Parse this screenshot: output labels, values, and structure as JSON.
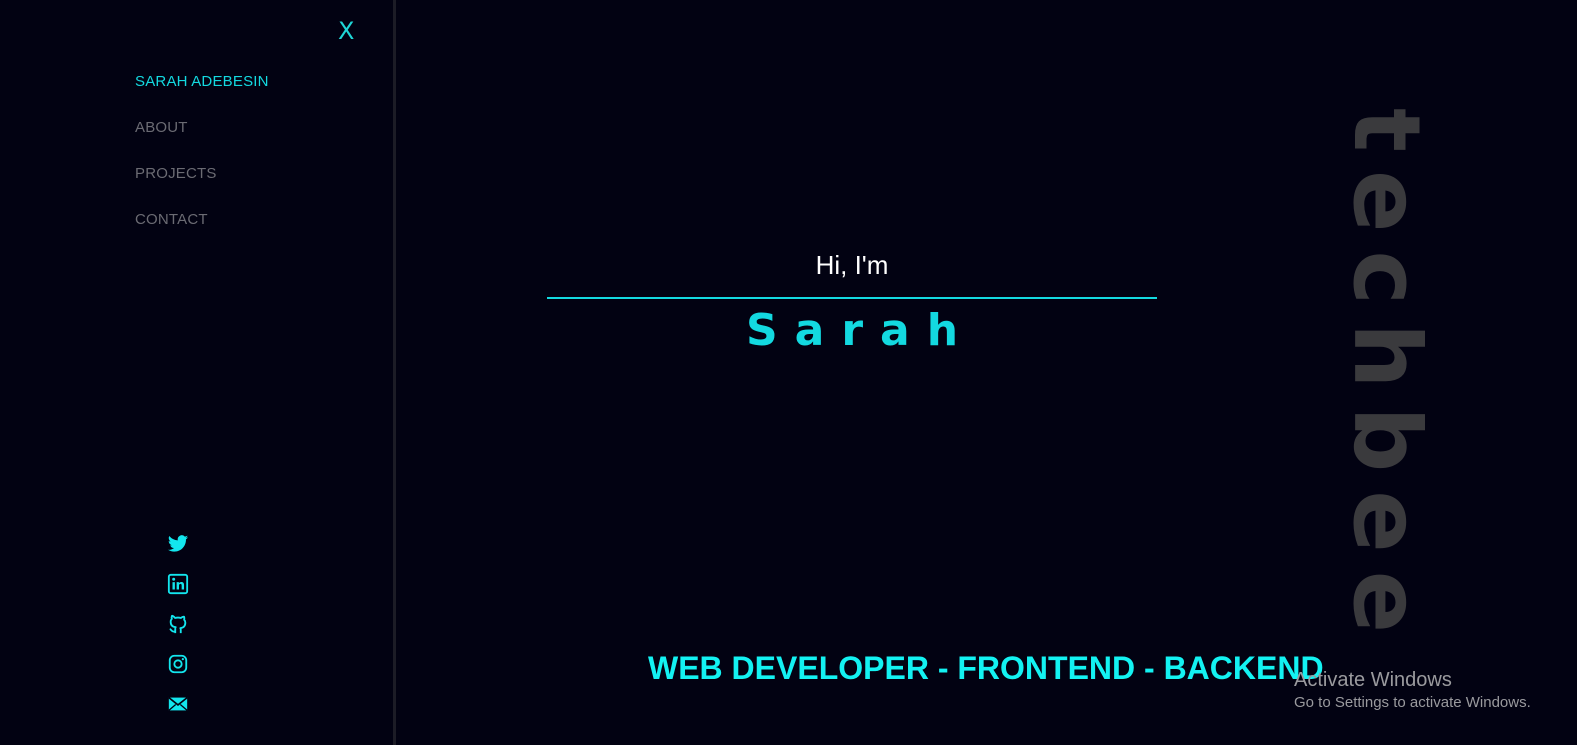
{
  "sidebar": {
    "close_label": "X",
    "nav": [
      {
        "label": "SARAH ADEBESIN",
        "active": true
      },
      {
        "label": "ABOUT",
        "active": false
      },
      {
        "label": "PROJECTS",
        "active": false
      },
      {
        "label": "CONTACT",
        "active": false
      }
    ],
    "socials": [
      "twitter-icon",
      "linkedin-icon",
      "github-icon",
      "instagram-icon",
      "mail-icon"
    ]
  },
  "hero": {
    "greeting": "Hi, I'm",
    "name": "Sarah",
    "role": "WEB DEVELOPER - FRONTEND - BACKEND",
    "side_logo": "techbee"
  },
  "watermark": {
    "title": "Activate Windows",
    "subtitle": "Go to Settings to activate Windows."
  },
  "colors": {
    "background": "#020212",
    "accent": "#13d9e0",
    "muted_nav": "#6b6b73",
    "side_logo": "#3a3a3d"
  }
}
